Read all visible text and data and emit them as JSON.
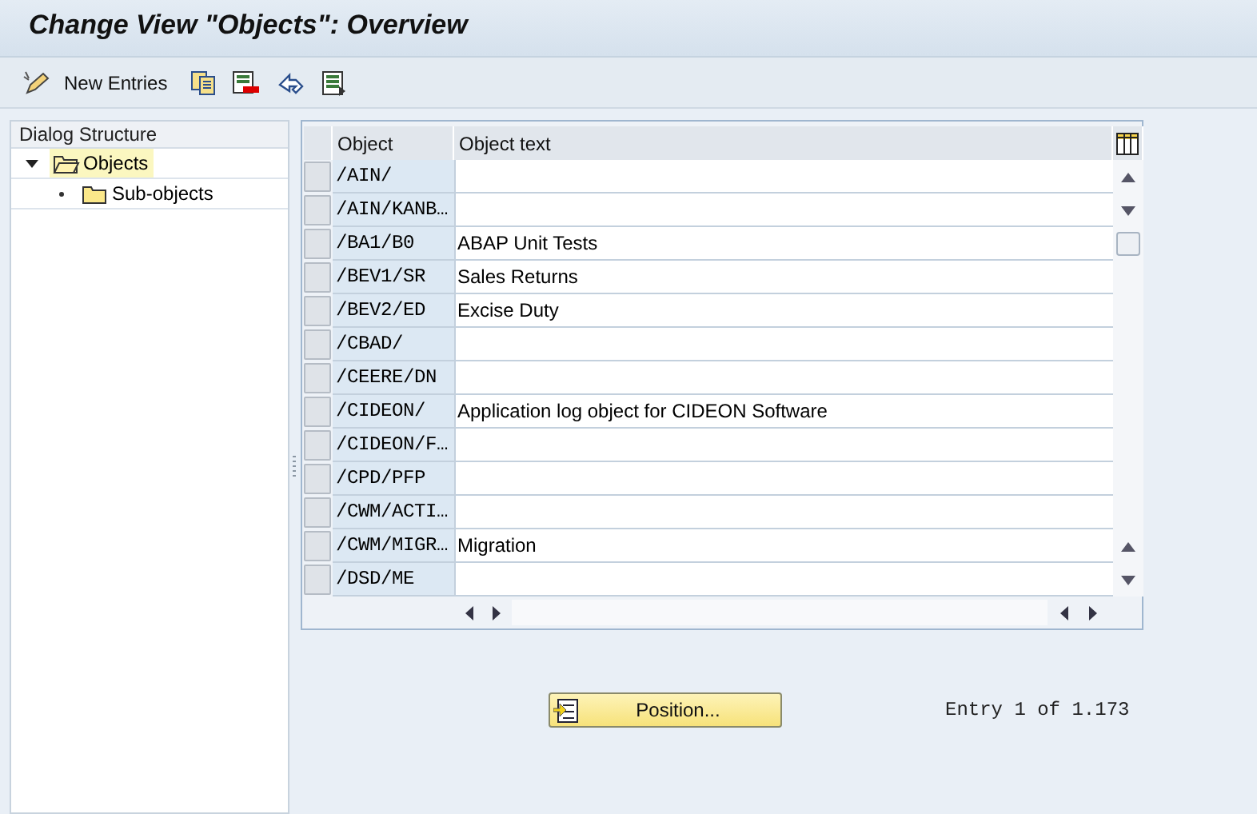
{
  "window": {
    "title": "Change View \"Objects\": Overview"
  },
  "toolbar": {
    "new_entries": "New Entries"
  },
  "dialog_structure": {
    "title": "Dialog Structure",
    "items": [
      {
        "label": "Objects",
        "selected": true,
        "expanded": true,
        "children": [
          {
            "label": "Sub-objects",
            "selected": false
          }
        ]
      }
    ]
  },
  "table": {
    "columns": [
      "Object",
      "Object text"
    ],
    "rows": [
      {
        "object": "/AIN/",
        "selected": false
      },
      {
        "object": "/AIN/KANB…",
        "selected": false
      },
      {
        "object": "/BA1/B0",
        "text": "ABAP Unit Tests",
        "selected": false
      },
      {
        "object": "/BEV1/SR",
        "text": "Sales Returns",
        "selected": false
      },
      {
        "object": "/BEV2/ED",
        "text": "Excise Duty",
        "selected": false
      },
      {
        "object": "/CBAD/",
        "selected": false
      },
      {
        "object": "/CEERE/DN",
        "selected": false
      },
      {
        "object": "/CIDEON/",
        "text": "Application log object for CIDEON Software",
        "selected": false
      },
      {
        "object": "/CIDEON/F…",
        "selected": false
      },
      {
        "object": "/CPD/PFP",
        "selected": false
      },
      {
        "object": "/CWM/ACTI…",
        "selected": false
      },
      {
        "object": "/CWM/MIGR…",
        "text": "Migration",
        "selected": false
      },
      {
        "object": "/DSD/ME",
        "selected": false
      }
    ]
  },
  "position_button": "Position...",
  "entry_info": "Entry 1 of 1.173"
}
